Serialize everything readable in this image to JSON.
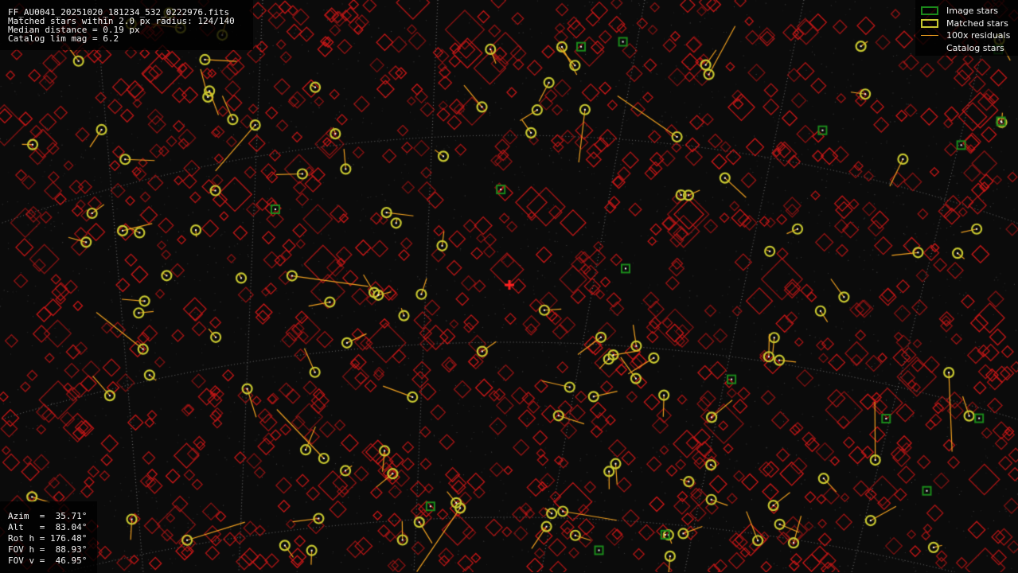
{
  "info": {
    "filename": "FF_AU0041_20251020_181234_532_0222976.fits",
    "matched_line": "Matched stars within 2.0 px radius: 124/140",
    "median_line": "Median distance = 0.19 px",
    "catalog_line": "Catalog lim mag = 6.2"
  },
  "params": {
    "azim": "Azim  =  35.71°",
    "alt": "Alt   =  83.04°",
    "rot": "Rot h = 176.48°",
    "fov_h": "FOV h =  88.93°",
    "fov_v": "FOV v =  46.95°"
  },
  "legend": {
    "image_stars": "Image stars",
    "matched_stars": "Matched stars",
    "residuals": "100x residuals",
    "catalog_stars": "Catalog stars"
  },
  "colors": {
    "catalog": "#d01818",
    "image": "#1b8a1b",
    "matched": "#c8c830",
    "residual": "#f0a020",
    "center_marker": "#ff2020",
    "grid": "#7a7a7a"
  },
  "icons": {
    "center_marker": "plus-icon"
  }
}
